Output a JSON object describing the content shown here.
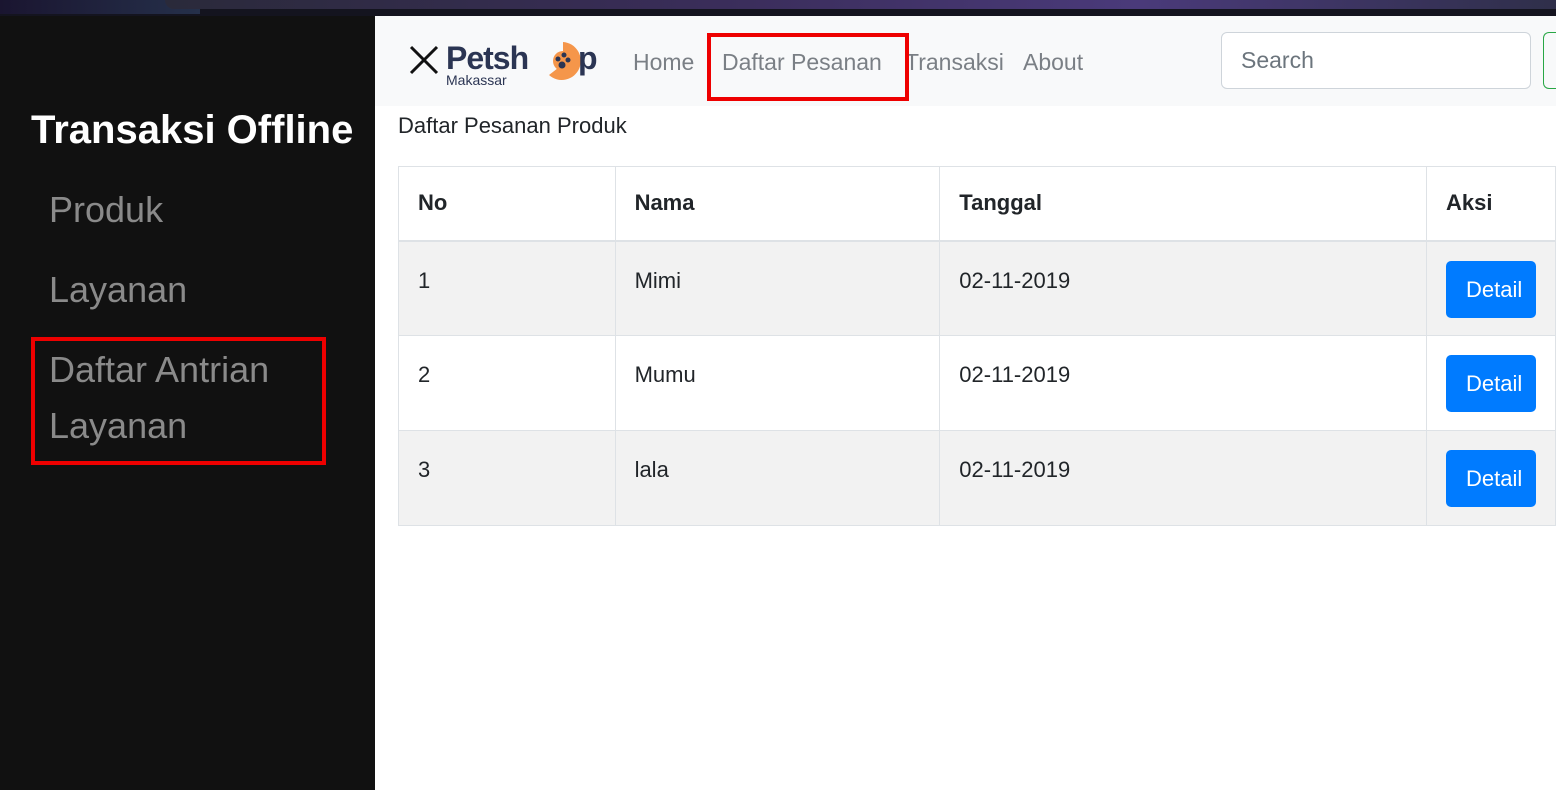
{
  "sidebar": {
    "title": "Transaksi Offline",
    "items": [
      {
        "label": "Produk"
      },
      {
        "label": "Layanan"
      },
      {
        "label": "Daftar Antrian Layanan"
      }
    ]
  },
  "navbar": {
    "brand": {
      "word": "Petsh",
      "suffix": "p",
      "sub": "Makassar"
    },
    "links": [
      {
        "label": "Home"
      },
      {
        "label": "Daftar Pesanan"
      },
      {
        "label": "Transaksi"
      },
      {
        "label": "About"
      }
    ],
    "search": {
      "placeholder": "Search"
    }
  },
  "main": {
    "heading": "Daftar Pesanan Produk",
    "table": {
      "headers": [
        "No",
        "Nama",
        "Tanggal",
        "Aksi"
      ],
      "rows": [
        {
          "no": "1",
          "nama": "Mimi",
          "tanggal": "02-11-2019",
          "aksi": "Detail"
        },
        {
          "no": "2",
          "nama": "Mumu",
          "tanggal": "02-11-2019",
          "aksi": "Detail"
        },
        {
          "no": "3",
          "nama": "lala",
          "tanggal": "02-11-2019",
          "aksi": "Detail"
        }
      ]
    }
  },
  "colors": {
    "accent": "#007bff",
    "highlight": "#e00000",
    "brand_orange": "#f5964a",
    "brand_navy": "#2b3553"
  }
}
